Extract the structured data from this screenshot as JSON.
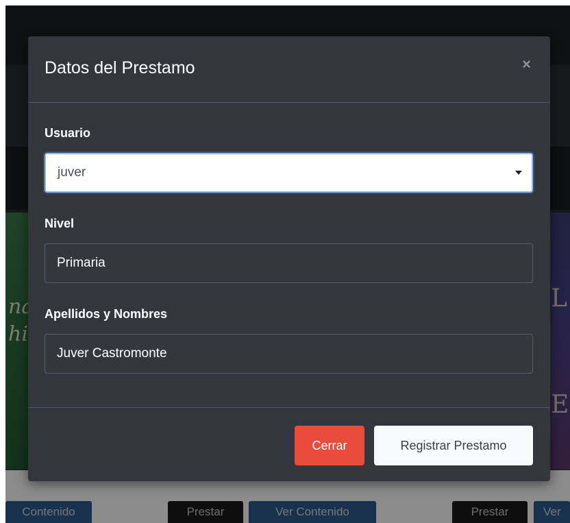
{
  "modal": {
    "title": "Datos del Prestamo",
    "close_symbol": "×",
    "fields": {
      "usuario": {
        "label": "Usuario",
        "value": "juver"
      },
      "nivel": {
        "label": "Nivel",
        "value": "Primaria"
      },
      "nombres": {
        "label": "Apellidos y Nombres",
        "value": "Juver Castromonte"
      }
    },
    "buttons": {
      "cerrar": "Cerrar",
      "registrar": "Registrar Prestamo"
    }
  },
  "background": {
    "buttons": [
      "Contenido",
      "Prestar",
      "Ver Contenido",
      "Prestar",
      "Ver"
    ]
  },
  "colors": {
    "modal_bg": "#33373d",
    "danger": "#e74c3c",
    "light": "#f8f9fa",
    "focus_border": "#8fb8f2"
  },
  "icons": {
    "close": "close-icon",
    "dropdown": "chevron-down-icon"
  }
}
